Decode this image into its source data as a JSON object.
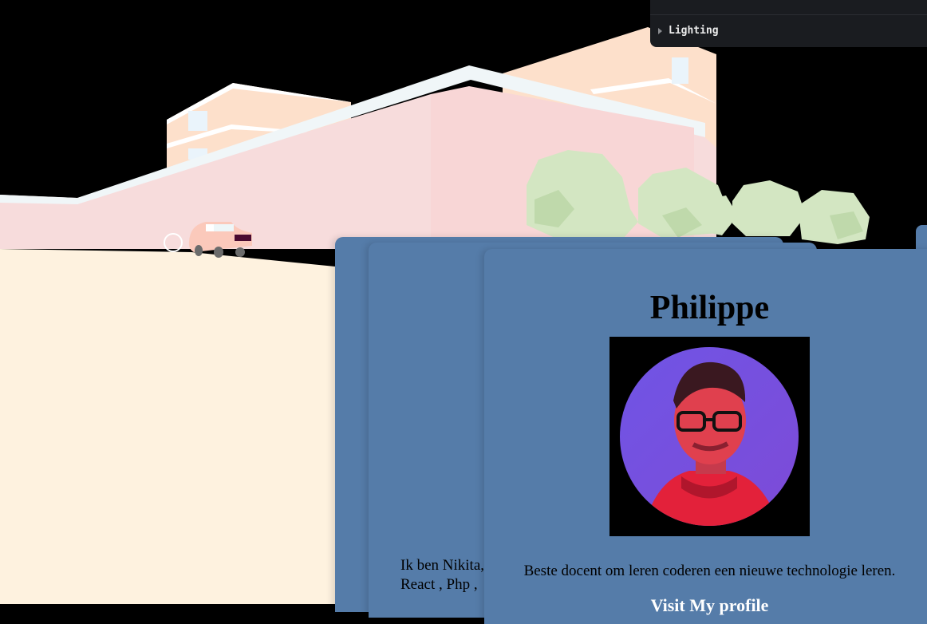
{
  "gui": {
    "folder_label": "Lighting"
  },
  "cards": [
    {
      "description": "Ik ben Nikita,\nReact , Php ,"
    },
    {
      "name": "Philippe",
      "description": "Beste docent om leren coderen een nieuwe technologie leren.",
      "link_label": "Visit My profile"
    }
  ],
  "colors": {
    "card": "#557ca9",
    "ground": "#fef2df",
    "building": "#f7dcdc",
    "background": "#000000"
  }
}
